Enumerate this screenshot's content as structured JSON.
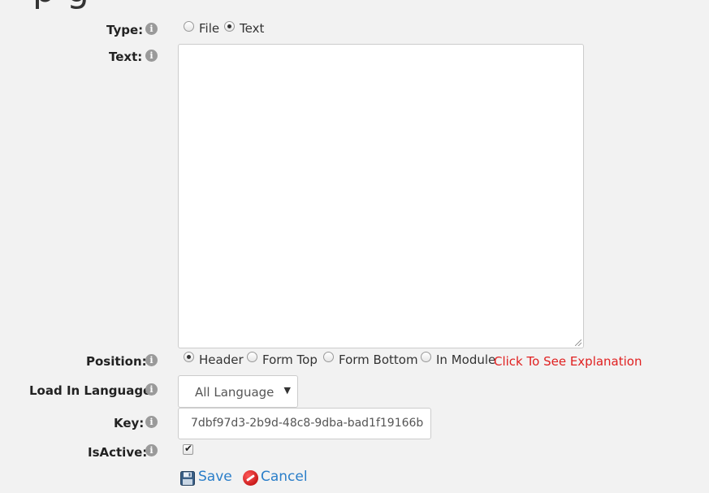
{
  "page": {
    "heading_fragment": "p     g"
  },
  "form": {
    "type": {
      "label": "Type:",
      "options": [
        "File",
        "Text"
      ],
      "selected": "Text"
    },
    "text": {
      "label": "Text:",
      "value": ""
    },
    "position": {
      "label": "Position:",
      "options": [
        "Header",
        "Form Top",
        "Form Bottom",
        "In Module"
      ],
      "selected": "Header",
      "explanation_link": "Click To See Explanation"
    },
    "language": {
      "label": "Load In Language:",
      "value": "All Language"
    },
    "key": {
      "label": "Key:",
      "value": "7dbf97d3-2b9d-48c8-9dba-bad1f19166b"
    },
    "isactive": {
      "label": "IsActive:",
      "checked": true
    }
  },
  "actions": {
    "save": "Save",
    "cancel": "Cancel"
  },
  "colors": {
    "link_red": "#e02020",
    "link_blue": "#2a7ec9"
  }
}
